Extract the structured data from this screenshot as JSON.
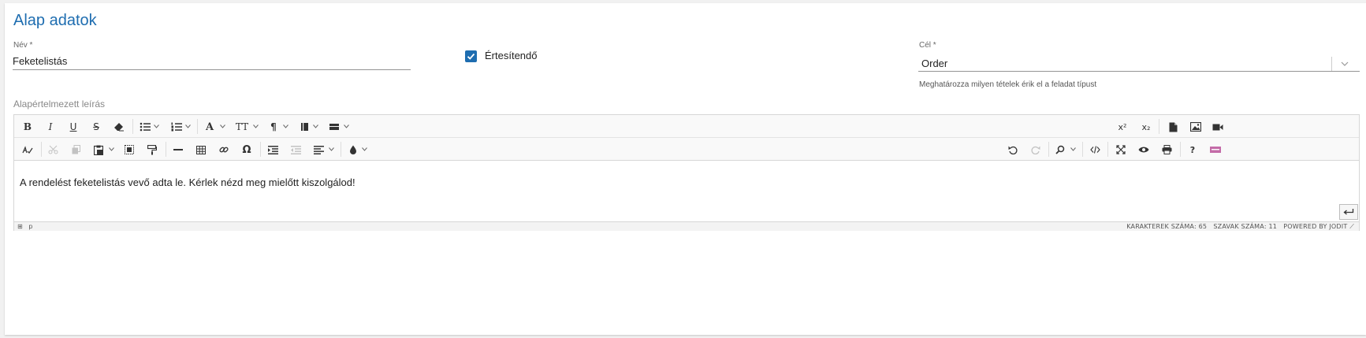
{
  "section": {
    "title": "Alap adatok"
  },
  "name_field": {
    "label": "Név *",
    "value": "Feketelistás"
  },
  "notify": {
    "label": "Értesítendő",
    "checked": true
  },
  "target_field": {
    "label": "Cél *",
    "value": "Order",
    "hint": "Meghatározza milyen tételek érik el a feladat típust"
  },
  "editor": {
    "label": "Alapértelmezett leírás",
    "content": "A rendelést feketelistás vevő adta le. Kérlek nézd meg mielőtt kiszolgálod!",
    "status_path": "p",
    "char_count": "KARAKTEREK SZÁMA: 65",
    "word_count": "SZAVAK SZÁMA: 11",
    "powered_by": "POWERED BY JODIT",
    "toolbar_row1": {
      "bold": "B",
      "italic": "I",
      "underline": "U",
      "strikethrough": "S",
      "font": "A",
      "font_size": "TT",
      "paragraph": "¶",
      "superscript": "x²",
      "subscript": "x₂"
    },
    "toolbar_row2": {
      "special_char": "Ω",
      "help": "?"
    }
  },
  "colors": {
    "accent": "#1e6db0"
  }
}
